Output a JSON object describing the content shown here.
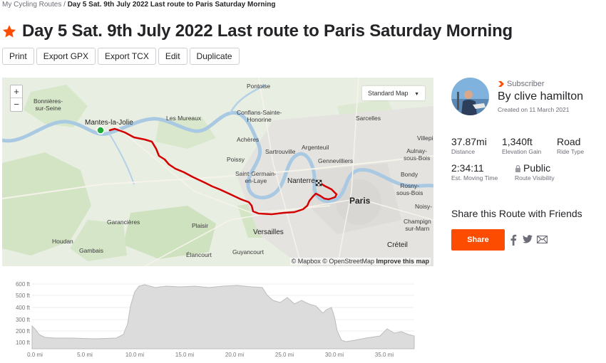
{
  "breadcrumb": {
    "parent": "My Cycling Routes",
    "separator": "/",
    "current": "Day 5 Sat. 9th July 2022 Last route to Paris Saturday Morning"
  },
  "route": {
    "title": "Day 5 Sat. 9th July 2022 Last route to Paris Saturday Morning",
    "star_color": "#fc4c02"
  },
  "toolbar": {
    "print": "Print",
    "export_gpx": "Export GPX",
    "export_tcx": "Export TCX",
    "edit": "Edit",
    "duplicate": "Duplicate"
  },
  "map": {
    "zoom_in": "+",
    "zoom_out": "−",
    "style_label": "Standard Map",
    "attribution_mapbox": "© Mapbox",
    "attribution_osm": "© OpenStreetMap",
    "attribution_improve": "Improve this map",
    "route_color": "#d40000",
    "labels": {
      "bonnieres": "Bonnières-\nsur-Seine",
      "pontoise": "Pontoise",
      "mantes": "Mantes-la-Jolie",
      "lesmureaux": "Les Mureaux",
      "conflans": "Conflans-Sainte-\nHonorine",
      "sarcelles": "Sarcelles",
      "villepi": "Villepi",
      "acheres": "Achères",
      "argenteuil": "Argenteuil",
      "aulnay": "Aulnay-\nsous-Bois",
      "sartrouville": "Sartrouville",
      "gennevilliers": "Gennevilliers",
      "poissy": "Poissy",
      "bondy": "Bondy",
      "stgermain": "Saint-Germain-\nen-Laye",
      "nanterre": "Nanterre",
      "rosny": "Rosny-\nsous-Bois",
      "paris": "Paris",
      "noisy": "Noisy-",
      "garancieres": "Garancières",
      "plaisir": "Plaisir",
      "champigny": "Champign\nsur-Marn",
      "versailles": "Versailles",
      "houdan": "Houdan",
      "gambais": "Gambais",
      "elancourt": "Élancourt",
      "guyancourt": "Guyancourt",
      "creteil": "Créteil"
    }
  },
  "elevation": {
    "y_ticks": [
      "600 ft",
      "500 ft",
      "400 ft",
      "300 ft",
      "200 ft",
      "100 ft"
    ],
    "x_ticks": [
      "0.0 mi",
      "5.0 mi",
      "10.0 mi",
      "15.0 mi",
      "20.0 mi",
      "25.0 mi",
      "30.0 mi",
      "35.0 mi"
    ]
  },
  "athlete": {
    "subscriber": "Subscriber",
    "name": "By clive hamilton",
    "created": "Created on 11 March 2021"
  },
  "stats": {
    "distance": {
      "value": "37.87mi",
      "label": "Distance"
    },
    "elevation": {
      "value": "1,340ft",
      "label": "Elevation Gain"
    },
    "type": {
      "value": "Road",
      "label": "Ride Type"
    },
    "time": {
      "value": "2:34:11",
      "label": "Est. Moving Time"
    },
    "visibility": {
      "value": "Public",
      "label": "Route Visibility"
    }
  },
  "share": {
    "title": "Share this Route with Friends",
    "button": "Share"
  },
  "colors": {
    "accent": "#fc4c02",
    "text": "#242428",
    "muted": "#6d6d78"
  }
}
